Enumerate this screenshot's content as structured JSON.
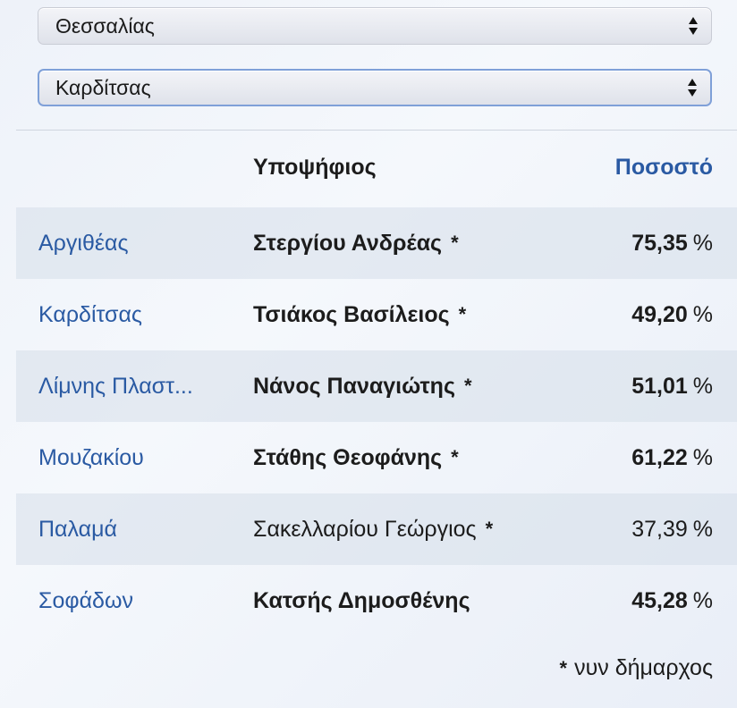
{
  "filters": {
    "region": "Θεσσαλίας",
    "prefecture": "Καρδίτσας"
  },
  "table": {
    "headers": {
      "municipality": "",
      "candidate": "Υποψήφιος",
      "percentage": "Ποσοστό"
    },
    "rows": [
      {
        "municipality": "Αργιθέας",
        "candidate": "Στεργίου Ανδρέας",
        "star": "*",
        "pct": "75,35",
        "unit": "%",
        "bold": true
      },
      {
        "municipality": "Καρδίτσας",
        "candidate": "Τσιάκος Βασίλειος",
        "star": "*",
        "pct": "49,20",
        "unit": "%",
        "bold": true
      },
      {
        "municipality": "Λίμνης Πλαστ...",
        "candidate": "Νάνος Παναγιώτης",
        "star": "*",
        "pct": "51,01",
        "unit": "%",
        "bold": true
      },
      {
        "municipality": "Μουζακίου",
        "candidate": "Στάθης Θεοφάνης",
        "star": "*",
        "pct": "61,22",
        "unit": "%",
        "bold": true
      },
      {
        "municipality": "Παλαμά",
        "candidate": "Σακελλαρίου Γεώργιος",
        "star": "*",
        "pct": "37,39",
        "unit": "%",
        "bold": false
      },
      {
        "municipality": "Σοφάδων",
        "candidate": "Κατσής Δημοσθένης",
        "star": "",
        "pct": "45,28",
        "unit": "%",
        "bold": true
      }
    ]
  },
  "footnote": {
    "star": "*",
    "text": "νυν δήμαρχος"
  },
  "colors": {
    "link": "#2a5aa3",
    "text": "#1c1c1c",
    "row_shade": "#d6deea"
  }
}
